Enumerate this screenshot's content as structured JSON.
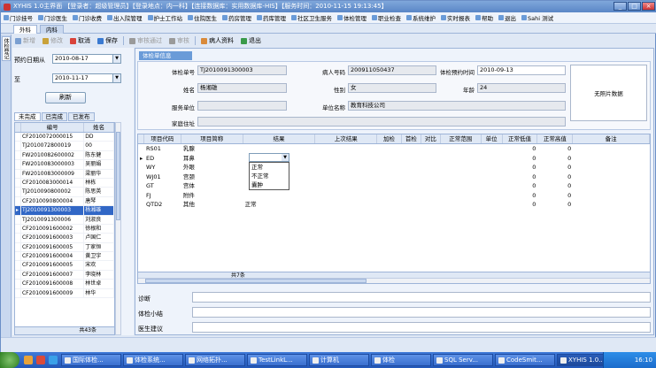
{
  "window": {
    "title": "XYHIS 1.0主界面 【登录者：超级管理员】【登录地点：内一科】【连接数据库：实用数据库-HIS】【服务时间：2010-11-15 19:13:45】"
  },
  "menu": [
    "门诊挂号",
    "门诊医生",
    "门诊收费",
    "出入院管理",
    "护士工作站",
    "住院医生",
    "药房管理",
    "药库管理",
    "社区卫生服务",
    "体检管理",
    "职业检查",
    "系统维护",
    "实时报表",
    "帮助",
    "退出",
    "Sahi 测试"
  ],
  "tabs": [
    "外科",
    "内科"
  ],
  "vertical_tab": "体检登记",
  "toolbar": {
    "items": [
      {
        "label": "新增",
        "icon": "add-icon",
        "enabled": false
      },
      {
        "label": "修改",
        "icon": "edit-icon",
        "enabled": false
      },
      {
        "label": "取消",
        "icon": "cancel-icon",
        "enabled": true
      },
      {
        "label": "保存",
        "icon": "save-icon",
        "enabled": true
      },
      {
        "label": "审核通过",
        "icon": "approve-icon",
        "enabled": false
      },
      {
        "label": "审核",
        "icon": "audit-icon",
        "enabled": false
      },
      {
        "label": "病人资料",
        "icon": "patient-icon",
        "enabled": true
      },
      {
        "label": "退出",
        "icon": "exit-icon",
        "enabled": true
      }
    ]
  },
  "left": {
    "from_label": "预约日期从",
    "from_value": "2010-08-17",
    "to_label": "至",
    "to_value": "2010-11-17",
    "refresh_label": "刷新",
    "subtabs": [
      "未完成",
      "已完成",
      "已发布"
    ],
    "columns": [
      "编号",
      "姓名"
    ],
    "rows": [
      [
        "CF2010072000015",
        "DD"
      ],
      [
        "TJ2010072800019",
        "00"
      ],
      [
        "FW2010082600002",
        "陈东健"
      ],
      [
        "FW2010083000003",
        "吴丽娟"
      ],
      [
        "FW2010083000009",
        "梁丽华"
      ],
      [
        "CF2010083000014",
        "林栋"
      ],
      [
        "TJ2010090800002",
        "陈思英"
      ],
      [
        "CF2010090800004",
        "唐琴"
      ],
      [
        "TJ2010091300003",
        "杨湘雄"
      ],
      [
        "TJ2010091300006",
        "刘淑良"
      ],
      [
        "CF2010091600002",
        "徐根和"
      ],
      [
        "CF2010091600003",
        "卢国仁"
      ],
      [
        "CF2010091600005",
        "丁家恒"
      ],
      [
        "CF2010091600004",
        "黄卫宇"
      ],
      [
        "CF2010091600005",
        "宋欢"
      ],
      [
        "CF2010091600007",
        "李晓林"
      ],
      [
        "CF2010091600008",
        "林世卓"
      ],
      [
        "CF2010091600009",
        "林华"
      ]
    ],
    "selected_row": 8,
    "footer": "共43条"
  },
  "right": {
    "section_title": "体检单信息",
    "fields": {
      "exam_no_label": "体检单号",
      "exam_no": "TJ2010091300003",
      "patient_no_label": "病人号码",
      "patient_no": "200911050437",
      "exam_time_label": "体检预约时间",
      "exam_time": "2010-09-13",
      "name_label": "姓名",
      "name": "杨湘雄",
      "gender_label": "性别",
      "gender": "女",
      "age_label": "年龄",
      "age": "24",
      "company_label": "服务单位",
      "company": "",
      "unit_name_label": "单位名称",
      "unit_name": "教育科技公司",
      "address_label": "家庭住址",
      "address": ""
    },
    "photo_text": "无照片数据",
    "grid": {
      "columns": [
        "项目代码",
        "项目简称",
        "结果",
        "上次结果",
        "加检",
        "首检",
        "对比",
        "正常范围",
        "单位",
        "正常低值",
        "正常高值",
        "备注"
      ],
      "rows": [
        [
          "RS01",
          "乳腺",
          "",
          "",
          "",
          "",
          "",
          "",
          "",
          "0",
          "0",
          ""
        ],
        [
          "ED",
          "耳鼻",
          "",
          "",
          "",
          "",
          "",
          "",
          "",
          "0",
          "0",
          ""
        ],
        [
          "WY",
          "外眼",
          "",
          "",
          "",
          "",
          "",
          "",
          "",
          "0",
          "0",
          ""
        ],
        [
          "WJ01",
          "宫颈",
          "",
          "",
          "",
          "",
          "",
          "",
          "",
          "0",
          "0",
          ""
        ],
        [
          "GT",
          "宫体",
          "",
          "",
          "",
          "",
          "",
          "",
          "",
          "0",
          "0",
          ""
        ],
        [
          "FJ",
          "附件",
          "",
          "",
          "",
          "",
          "",
          "",
          "",
          "0",
          "0",
          ""
        ],
        [
          "QTD2",
          "其他",
          "正常",
          "",
          "",
          "",
          "",
          "",
          "",
          "0",
          "0",
          ""
        ]
      ],
      "selected_row": 1,
      "dropdown_options": [
        "正常",
        "不正常",
        "囊肿"
      ],
      "footer": "共7条"
    },
    "diagnosis_label": "诊断",
    "summary_label": "体检小结",
    "advice_label": "医生建议"
  },
  "taskbar": {
    "tasks": [
      "国际体检...",
      "体检系统...",
      "网络拓扑...",
      "TestLinkL...",
      "计算机",
      "体检",
      "SQL Serv...",
      "CodeSmit...",
      "XYHIS 1.0..."
    ],
    "active_index": 8,
    "clock": "16:10"
  }
}
